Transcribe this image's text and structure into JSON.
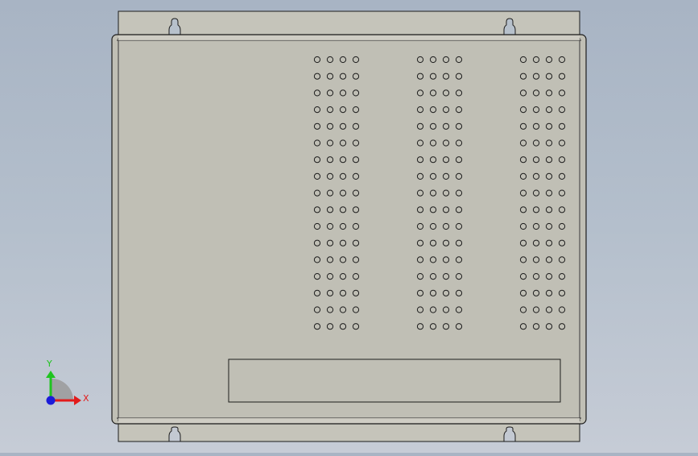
{
  "viewport": {
    "background_top": "#a8b4c4",
    "background_bottom": "#c6ccd6"
  },
  "model": {
    "panel_fill": "#c0bfb5",
    "flange_fill": "#c5c4ba",
    "edge_color": "#1c1c1c",
    "hole_grid": {
      "groups": 3,
      "columns_per_group": 4,
      "rows": 17
    }
  },
  "triad": {
    "x_label": "X",
    "y_label": "Y",
    "x_color": "#e21b1b",
    "y_color": "#1fc41f",
    "z_color": "#1b1bd9"
  }
}
